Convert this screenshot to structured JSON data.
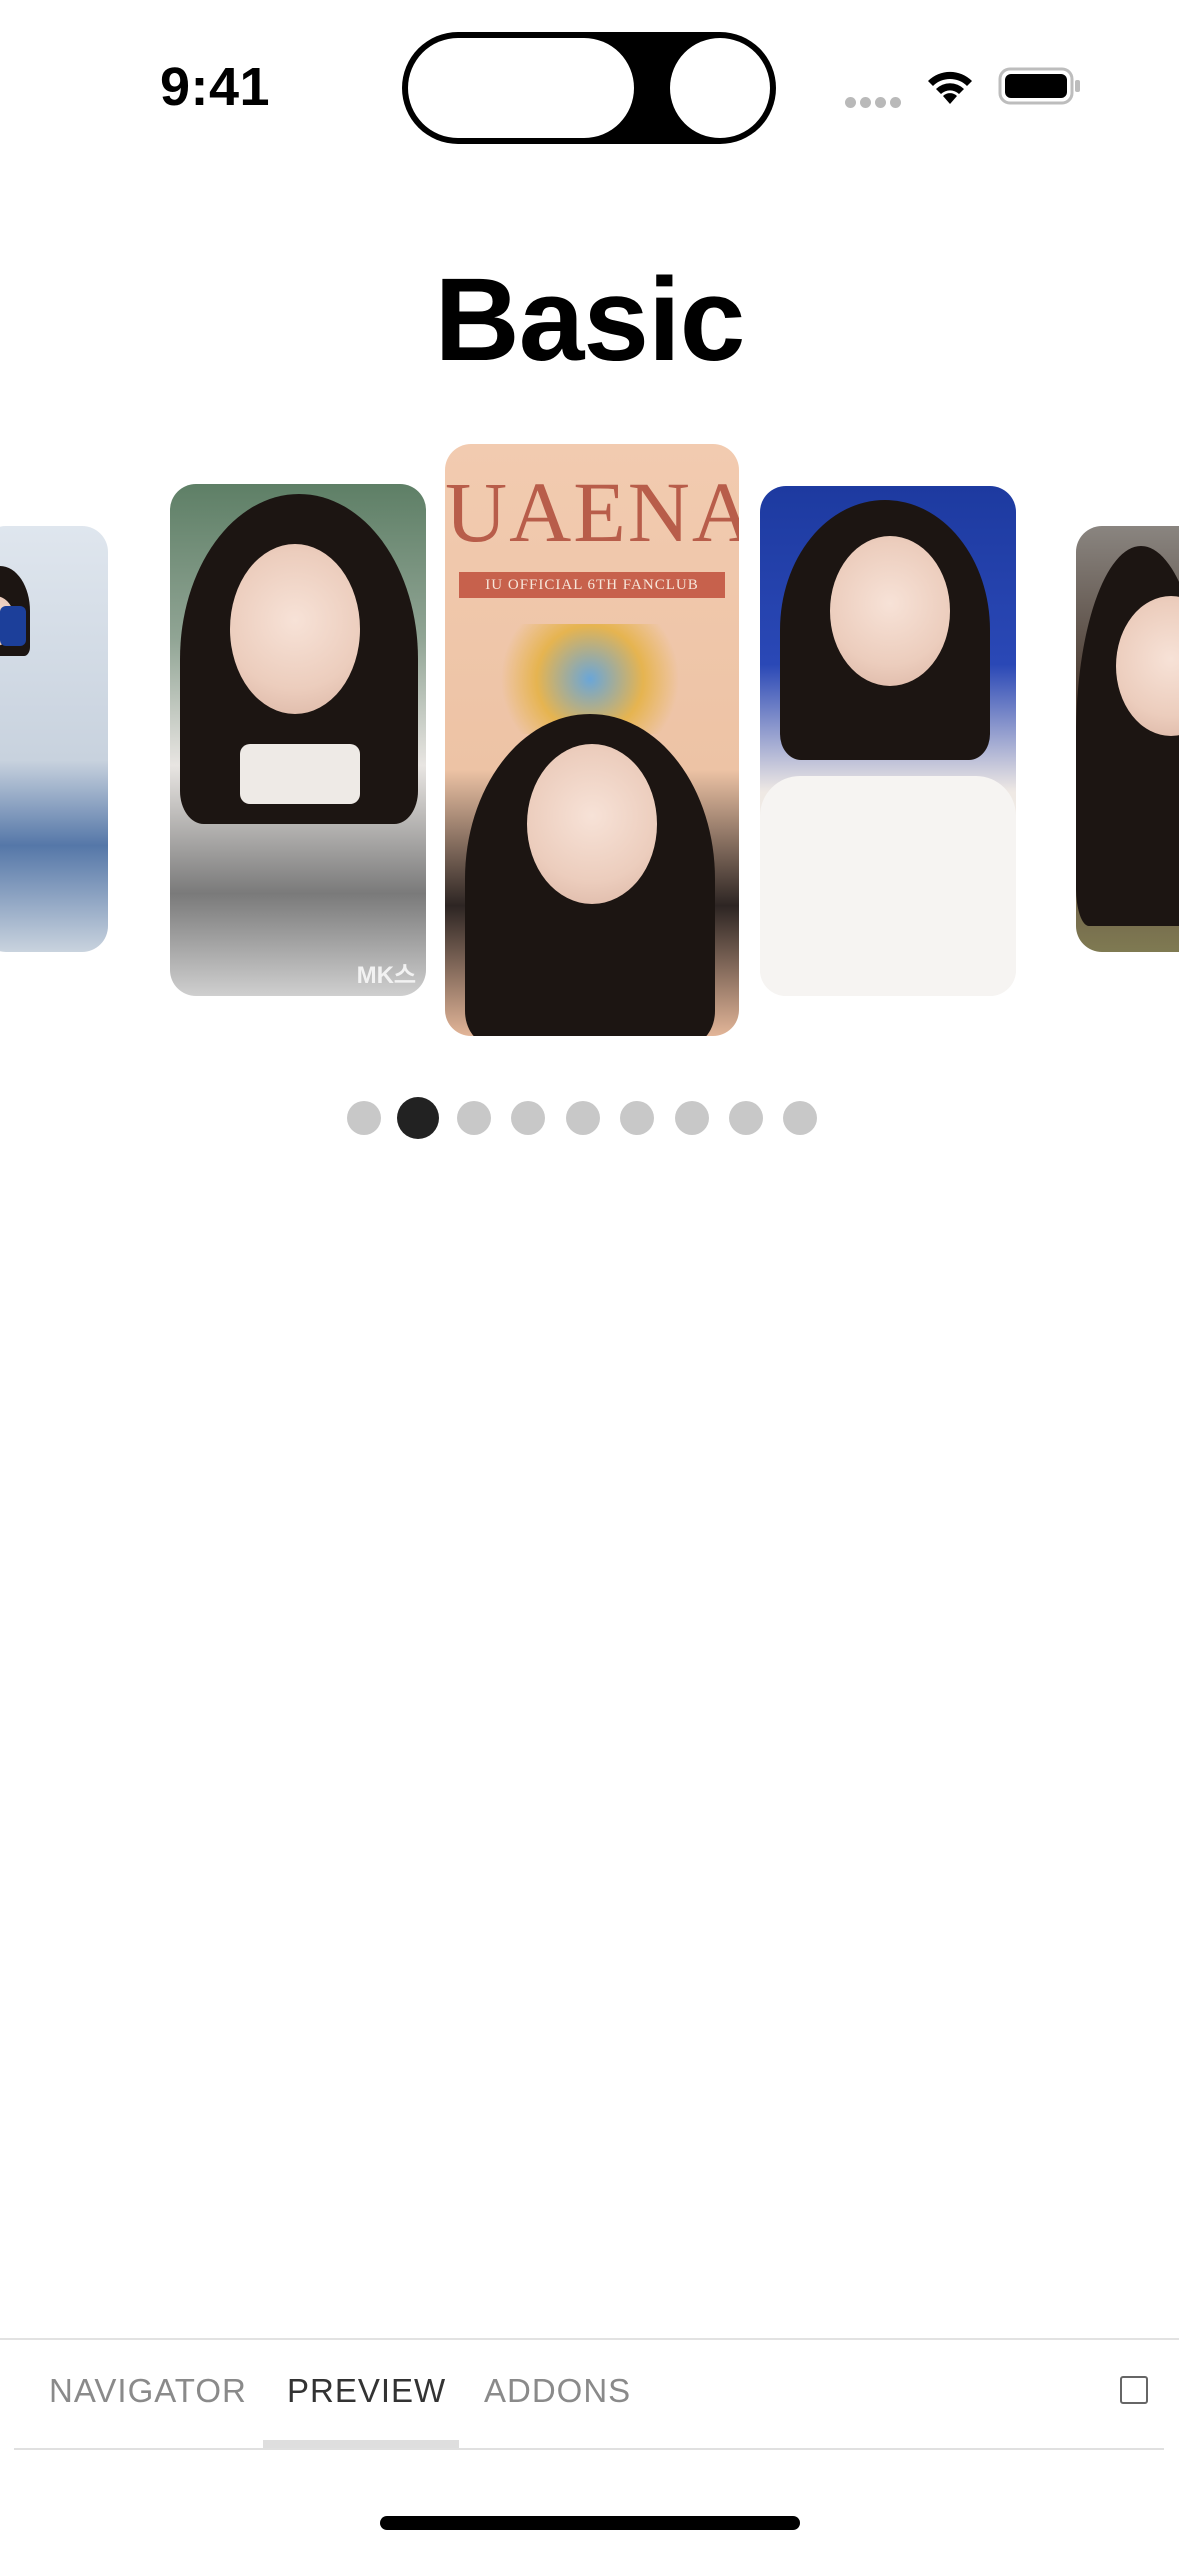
{
  "status_bar": {
    "time": "9:41",
    "icons": [
      "signal-dots-icon",
      "wifi-icon",
      "battery-icon"
    ]
  },
  "page": {
    "title": "Basic"
  },
  "carousel": {
    "slides": [
      {
        "name": "slide-far-left",
        "description_icon": "photo"
      },
      {
        "name": "slide-left",
        "description_icon": "photo"
      },
      {
        "name": "slide-center",
        "overlay_title": "UAENA",
        "overlay_subtitle": "IU OFFICIAL 6TH FANCLUB"
      },
      {
        "name": "slide-right",
        "description_icon": "photo"
      },
      {
        "name": "slide-far-right",
        "description_icon": "photo"
      }
    ],
    "left_slide_watermark": "MK스",
    "page_count": 9,
    "active_page": 2
  },
  "addon_panel": {
    "tabs": [
      {
        "label": "NAVIGATOR",
        "active": false
      },
      {
        "label": "PREVIEW",
        "active": true
      },
      {
        "label": "ADDONS",
        "active": false
      }
    ]
  },
  "colors": {
    "active_dot": "#222222",
    "inactive_dot": "#c8c8c8",
    "uaena_text": "#b85d4a"
  }
}
